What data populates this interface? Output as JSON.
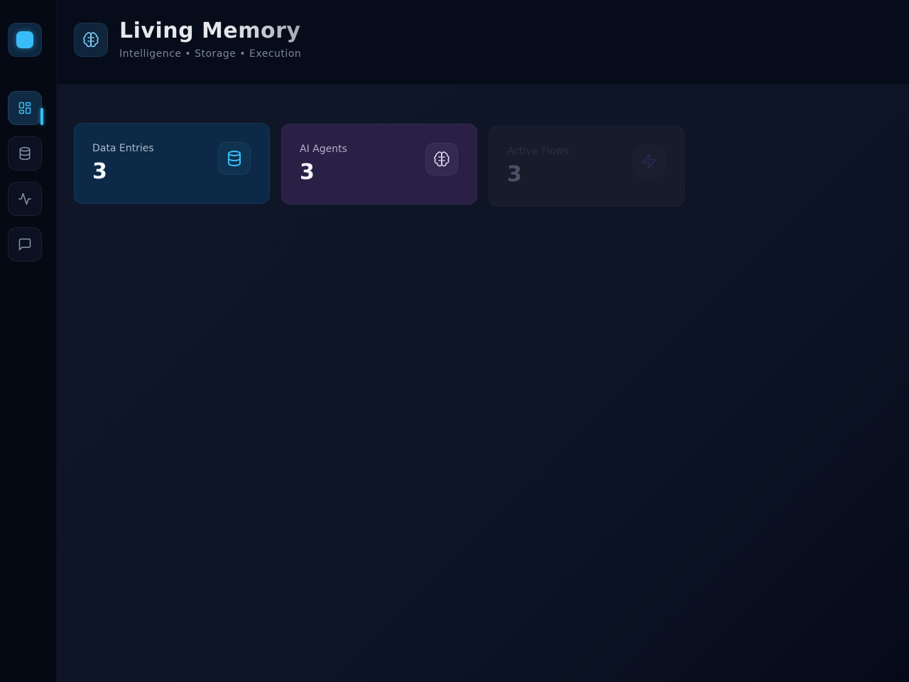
{
  "header": {
    "title": "Living Memory",
    "subtitle": "Intelligence • Storage • Execution",
    "icon": "brain-icon"
  },
  "sidebar": {
    "logo": "logo-square",
    "items": [
      {
        "name": "dashboard",
        "icon": "dashboard-icon",
        "active": true
      },
      {
        "name": "database",
        "icon": "database-icon",
        "active": false
      },
      {
        "name": "activity",
        "icon": "activity-icon",
        "active": false
      },
      {
        "name": "chat",
        "icon": "chat-icon",
        "active": false
      }
    ]
  },
  "stats": [
    {
      "label": "Data Entries",
      "value": "3",
      "icon": "database-icon",
      "accent": "#38bdf8"
    },
    {
      "label": "AI Agents",
      "value": "3",
      "icon": "brain-icon",
      "accent": "#c4b5fd"
    },
    {
      "label": "Active Flows",
      "value": "3",
      "icon": "lightning-icon",
      "accent": "#4c3f8a"
    }
  ],
  "colors": {
    "accent": "#38bdf8",
    "background": "#0d1527",
    "sidebar": "#050914"
  }
}
